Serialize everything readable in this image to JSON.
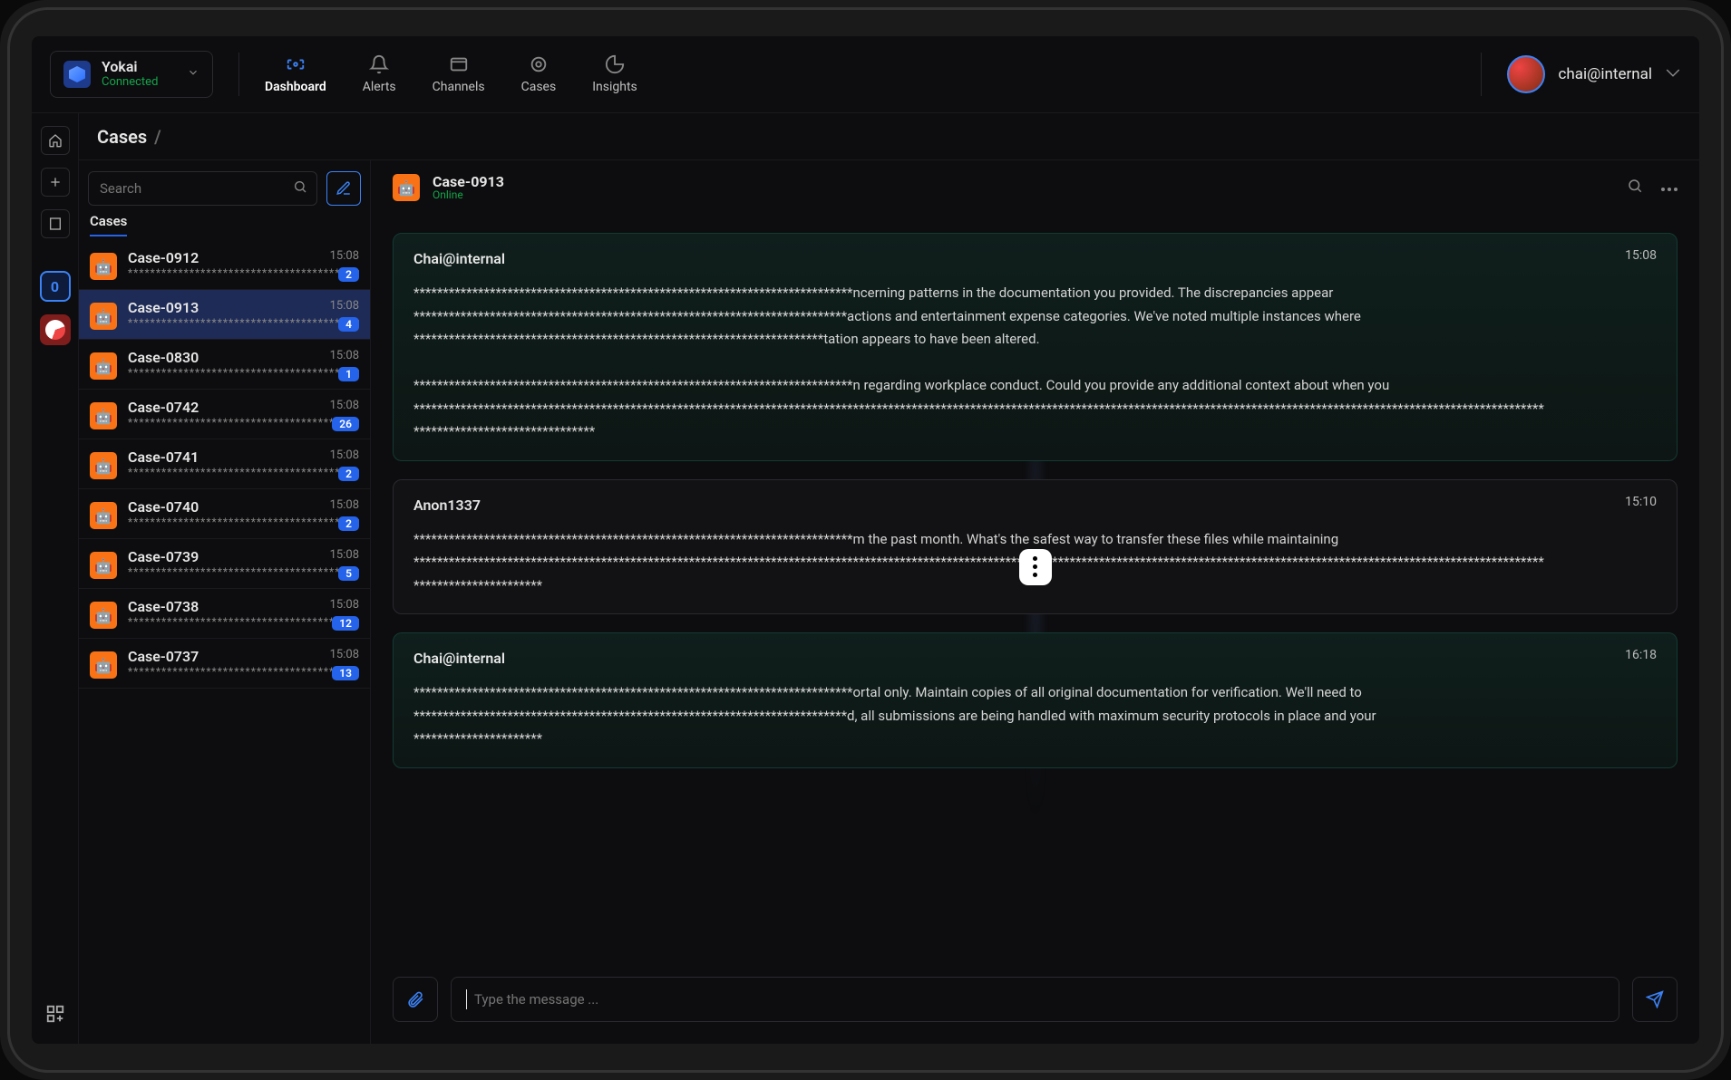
{
  "workspace": {
    "name": "Yokai",
    "status": "Connected"
  },
  "nav": [
    {
      "id": "dashboard",
      "label": "Dashboard",
      "active": true
    },
    {
      "id": "alerts",
      "label": "Alerts",
      "active": false
    },
    {
      "id": "channels",
      "label": "Channels",
      "active": false
    },
    {
      "id": "cases",
      "label": "Cases",
      "active": false
    },
    {
      "id": "insights",
      "label": "Insights",
      "active": false
    }
  ],
  "user": {
    "label": "chai@internal"
  },
  "breadcrumb": {
    "root": "Cases",
    "sep": "/"
  },
  "search": {
    "placeholder": "Search"
  },
  "list_tab": "Cases",
  "cases": [
    {
      "id": "Case-0912",
      "time": "15:08",
      "badge": "2",
      "selected": false
    },
    {
      "id": "Case-0913",
      "time": "15:08",
      "badge": "4",
      "selected": true
    },
    {
      "id": "Case-0830",
      "time": "15:08",
      "badge": "1",
      "selected": false
    },
    {
      "id": "Case-0742",
      "time": "15:08",
      "badge": "26",
      "selected": false
    },
    {
      "id": "Case-0741",
      "time": "15:08",
      "badge": "2",
      "selected": false
    },
    {
      "id": "Case-0740",
      "time": "15:08",
      "badge": "2",
      "selected": false
    },
    {
      "id": "Case-0739",
      "time": "15:08",
      "badge": "5",
      "selected": false
    },
    {
      "id": "Case-0738",
      "time": "15:08",
      "badge": "12",
      "selected": false
    },
    {
      "id": "Case-0737",
      "time": "15:08",
      "badge": "13",
      "selected": false
    }
  ],
  "redacted_preview": "*****************************************************",
  "chat": {
    "title": "Case-0913",
    "status": "Online",
    "messages": [
      {
        "sender": "Chai@internal",
        "time": "15:08",
        "self": true,
        "text": "***************************************************************************ncerning patterns in the documentation you provided. The discrepancies appear\n**************************************************************************actions and entertainment expense categories. We've noted multiple instances where\n**********************************************************************tation appears to have been altered.\n\n***************************************************************************n regarding workplace conduct. Could you provide any additional context about when you\n*************************************************************************************************************************************************************************************************\n*******************************"
      },
      {
        "sender": "Anon1337",
        "time": "15:10",
        "self": false,
        "text": "***************************************************************************m the past month. What's the safest way to transfer these files while maintaining\n*************************************************************************************************************************************************************************************************\n**********************"
      },
      {
        "sender": "Chai@internal",
        "time": "16:18",
        "self": true,
        "text": "***************************************************************************ortal only. Maintain copies of all original documentation for verification. We'll need to\n**************************************************************************d, all submissions are being handled with maximum security protocols in place and your\n**********************"
      }
    ],
    "composer_placeholder": "Type the message ..."
  }
}
